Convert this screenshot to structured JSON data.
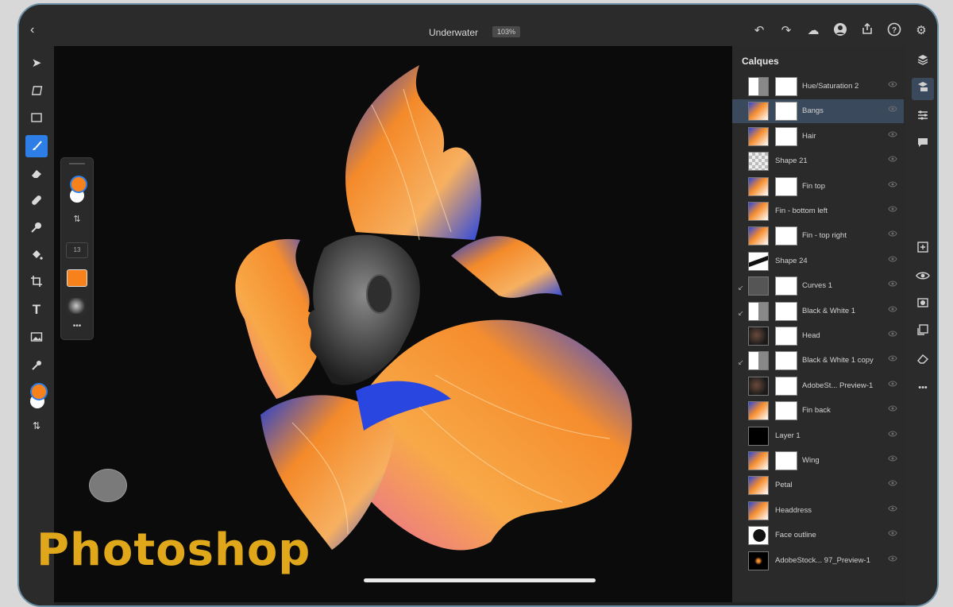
{
  "app": {
    "document_title": "Underwater",
    "zoom": "103%"
  },
  "layers_panel": {
    "title": "Calques",
    "layers": [
      {
        "name": "Hue/Saturation 2",
        "thumb": "adjust",
        "mask": true
      },
      {
        "name": "Bangs",
        "thumb": "fish",
        "mask": true,
        "selected": true
      },
      {
        "name": "Hair",
        "thumb": "fish",
        "mask": true
      },
      {
        "name": "Shape 21",
        "thumb": "checker",
        "mask": false
      },
      {
        "name": "Fin top",
        "thumb": "fish",
        "mask": true
      },
      {
        "name": "Fin - bottom left",
        "thumb": "fish",
        "mask": false
      },
      {
        "name": "Fin - top right",
        "thumb": "fish",
        "mask": true
      },
      {
        "name": "Shape 24",
        "thumb": "stroke",
        "mask": false
      },
      {
        "name": "Curves 1",
        "thumb": "curves",
        "mask": true,
        "clipped": true
      },
      {
        "name": "Black & White 1",
        "thumb": "adjust",
        "mask": true,
        "clipped": true
      },
      {
        "name": "Head",
        "thumb": "face",
        "mask": true
      },
      {
        "name": "Black & White 1 copy",
        "thumb": "adjust",
        "mask": true,
        "clipped": true
      },
      {
        "name": "AdobeSt... Preview-1",
        "thumb": "face",
        "mask": true
      },
      {
        "name": "Fin back",
        "thumb": "fish",
        "mask": true
      },
      {
        "name": "Layer 1",
        "thumb": "black",
        "mask": false
      },
      {
        "name": "Wing",
        "thumb": "fish",
        "mask": true
      },
      {
        "name": "Petal",
        "thumb": "fish",
        "mask": false
      },
      {
        "name": "Headdress",
        "thumb": "fish",
        "mask": false
      },
      {
        "name": "Face outline",
        "thumb": "silhouette",
        "mask": false
      },
      {
        "name": "AdobeStock... 97_Preview-1",
        "thumb": "dark",
        "mask": false
      }
    ]
  },
  "float_panel": {
    "brush_size": "13",
    "more": "•••"
  },
  "branding": {
    "watermark": "Photoshop"
  },
  "colors": {
    "accent_blue": "#2d7ee6",
    "foreground_color": "#f7821c",
    "background_color": "#ffffff",
    "brand_gold": "#e1a71b"
  },
  "icons": {
    "top": [
      "back-icon",
      "undo-icon",
      "redo-icon",
      "cloud-icon",
      "user-icon",
      "share-icon",
      "help-icon",
      "settings-icon"
    ],
    "left": [
      "move-icon",
      "transform-icon",
      "marquee-icon",
      "brush-icon",
      "eraser-icon",
      "healing-icon",
      "clone-icon",
      "fill-icon",
      "crop-icon",
      "type-icon",
      "image-icon",
      "eyedropper-icon"
    ],
    "right": [
      "layers-icon",
      "layer-properties-icon",
      "adjustments-icon",
      "comments-icon",
      "add-layer-icon",
      "visibility-icon",
      "mask-icon",
      "clip-icon",
      "eraser-layer-icon",
      "more-icon"
    ]
  }
}
